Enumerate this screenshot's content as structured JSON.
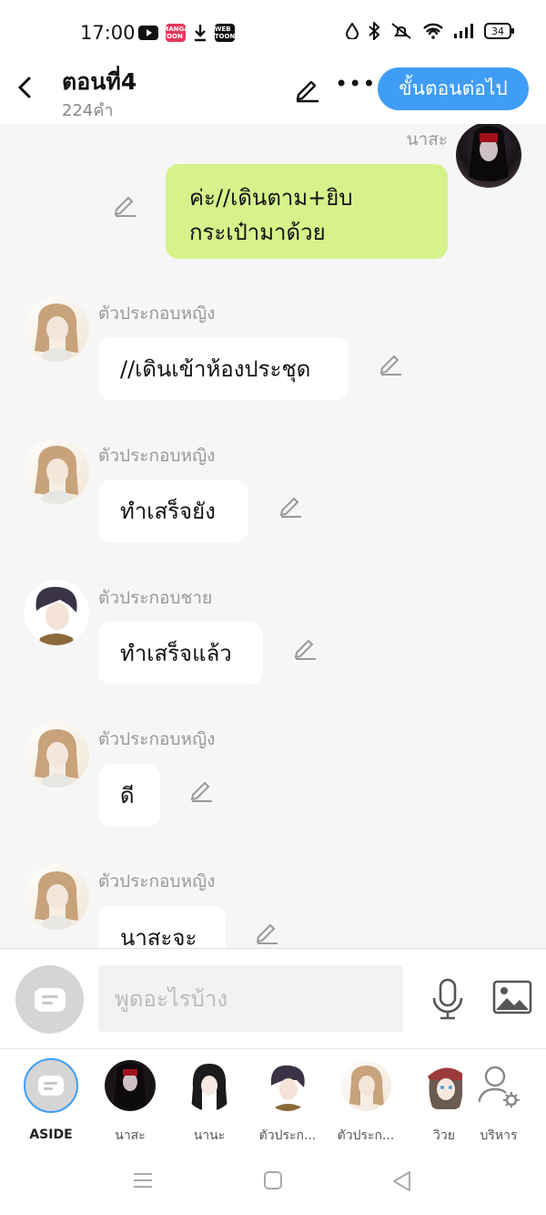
{
  "status": {
    "time": "17:00",
    "battery": "34",
    "app_badges": [
      "MANGA TOON",
      "WEB TOON"
    ]
  },
  "header": {
    "title": "ตอนที่4",
    "word_count": "224คำ",
    "next_button": "ขั้นตอนต่อไป"
  },
  "messages": [
    {
      "speaker": "นาสะ",
      "text_line1": "ค่ะ//เดินตาม+ยิบ",
      "text_line2": "กระเป๋ามาด้วย",
      "side": "right"
    },
    {
      "speaker": "ตัวประกอบหญิง",
      "text": "//เดินเข้าห้องประชุด",
      "side": "left"
    },
    {
      "speaker": "ตัวประกอบหญิง",
      "text": "ทำเสร็จยัง",
      "side": "left"
    },
    {
      "speaker": "ตัวประกอบชาย",
      "text": "ทำเสร็จแล้ว",
      "side": "left"
    },
    {
      "speaker": "ตัวประกอบหญิง",
      "text": "ดี",
      "side": "left"
    },
    {
      "speaker": "ตัวประกอบหญิง",
      "text": "นาสะจะ",
      "side": "left"
    }
  ],
  "input": {
    "placeholder": "พูดอะไรบ้าง"
  },
  "characters": [
    {
      "label": "ASIDE"
    },
    {
      "label": "นาสะ"
    },
    {
      "label": "นานะ"
    },
    {
      "label": "ตัวประก..."
    },
    {
      "label": "ตัวประก..."
    },
    {
      "label": "วิวย"
    },
    {
      "label": "บริหาร"
    }
  ],
  "colors": {
    "accent": "#3f9df7",
    "my_bubble": "#d6f28a",
    "background": "#f6f6f6"
  }
}
